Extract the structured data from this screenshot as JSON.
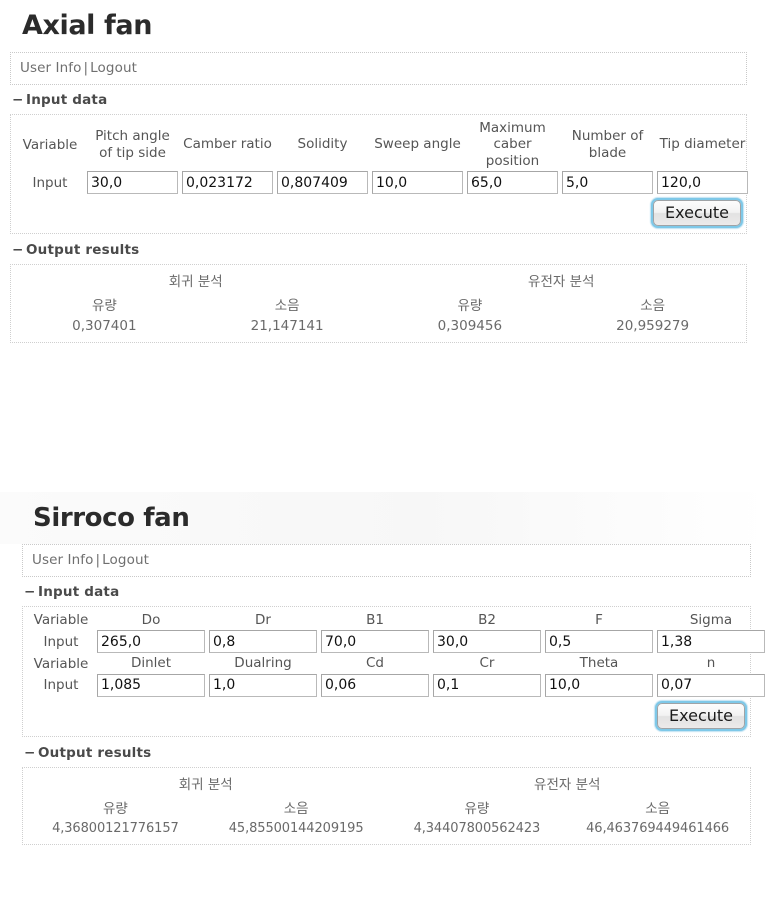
{
  "axial": {
    "title": "Axial fan",
    "userbar": {
      "user_info": "User Info",
      "separator": "|",
      "logout": "Logout"
    },
    "input_section": {
      "toggle": "−",
      "heading": "Input data"
    },
    "output_section": {
      "toggle": "−",
      "heading": "Output results"
    },
    "table": {
      "row_label_variable": "Variable",
      "row_label_input": "Input",
      "columns": [
        "Pitch angle of tip side",
        "Camber ratio",
        "Solidity",
        "Sweep angle",
        "Maximum caber position",
        "Number of blade",
        "Tip diameter"
      ],
      "values": [
        "30,0",
        "0,023172",
        "0,807409",
        "10,0",
        "65,0",
        "5,0",
        "120,0"
      ]
    },
    "execute_label": "Execute",
    "results": {
      "groups": [
        "회귀 분석",
        "유전자 분석"
      ],
      "metrics": [
        "유량",
        "소음",
        "유량",
        "소음"
      ],
      "values": [
        "0,307401",
        "21,147141",
        "0,309456",
        "20,959279"
      ]
    }
  },
  "sirroco": {
    "title": "Sirroco fan",
    "userbar": {
      "user_info": "User Info",
      "separator": "|",
      "logout": "Logout"
    },
    "input_section": {
      "toggle": "−",
      "heading": "Input data"
    },
    "output_section": {
      "toggle": "−",
      "heading": "Output results"
    },
    "table": {
      "row_label_variable": "Variable",
      "row_label_input": "Input",
      "columns_row1": [
        "Do",
        "Dr",
        "B1",
        "B2",
        "F",
        "Sigma"
      ],
      "values_row1": [
        "265,0",
        "0,8",
        "70,0",
        "30,0",
        "0,5",
        "1,38"
      ],
      "columns_row2": [
        "Dinlet",
        "Dualring",
        "Cd",
        "Cr",
        "Theta",
        "n"
      ],
      "values_row2": [
        "1,085",
        "1,0",
        "0,06",
        "0,1",
        "10,0",
        "0,07"
      ]
    },
    "execute_label": "Execute",
    "results": {
      "groups": [
        "회귀 분석",
        "유전자 분석"
      ],
      "metrics": [
        "유량",
        "소음",
        "유량",
        "소음"
      ],
      "values": [
        "4,36800121776157",
        "45,85500144209195",
        "4,34407800562423",
        "46,463769449461466"
      ]
    }
  },
  "colors": {
    "focus_ring": "#7ec8e8",
    "panel_border": "#cfcfcf",
    "text": "#555555"
  }
}
